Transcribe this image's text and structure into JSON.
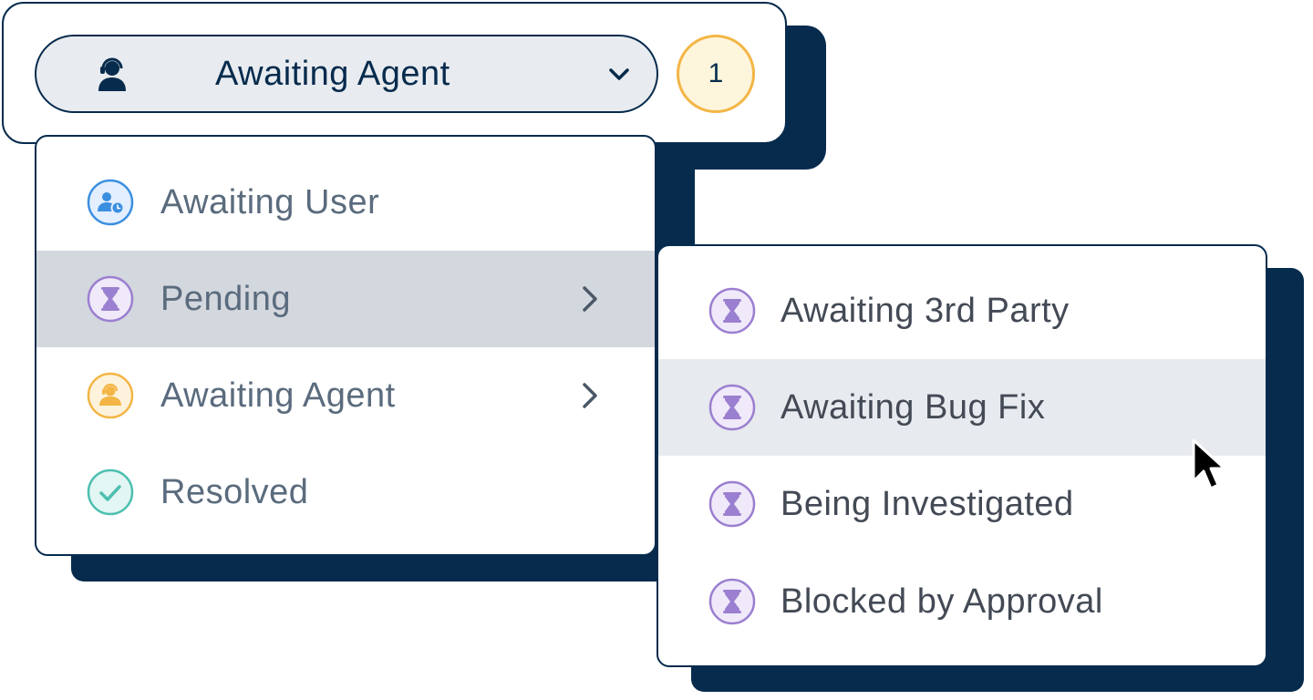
{
  "header": {
    "selected_status": "Awaiting Agent",
    "selected_icon": "agent-headset-icon",
    "count": "1"
  },
  "status_menu": {
    "items": [
      {
        "label": "Awaiting User",
        "icon": "user-clock-icon",
        "color": "#3b8fe0",
        "has_submenu": false
      },
      {
        "label": "Pending",
        "icon": "hourglass-icon",
        "color": "#9b7fd0",
        "has_submenu": true,
        "highlighted": true
      },
      {
        "label": "Awaiting Agent",
        "icon": "agent-headset-icon",
        "color": "#f3b545",
        "has_submenu": true
      },
      {
        "label": "Resolved",
        "icon": "check-circle-icon",
        "color": "#4dbfb0",
        "has_submenu": false
      }
    ]
  },
  "pending_submenu": {
    "items": [
      {
        "label": "Awaiting 3rd Party",
        "icon": "hourglass-icon"
      },
      {
        "label": "Awaiting Bug Fix",
        "icon": "hourglass-icon",
        "highlighted": true
      },
      {
        "label": "Being Investigated",
        "icon": "hourglass-icon"
      },
      {
        "label": "Blocked by Approval",
        "icon": "hourglass-icon"
      }
    ]
  },
  "colors": {
    "navy": "#062b4d",
    "pending_purple": "#9b7fd0",
    "user_blue": "#3b8fe0",
    "agent_amber": "#f3b545",
    "resolved_teal": "#4dbfb0"
  }
}
